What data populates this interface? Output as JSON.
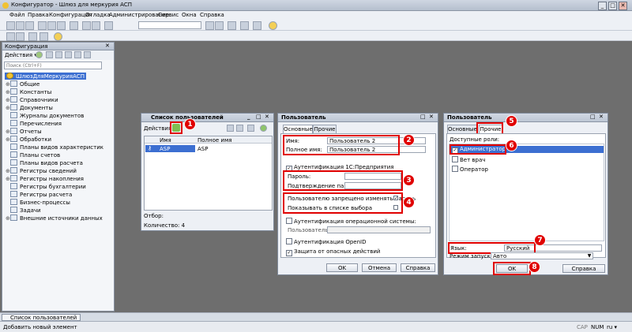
{
  "window": {
    "title": "Конфигуратор - Шлюз для меркурия АСП",
    "min": "_",
    "max": "□",
    "close": "✕"
  },
  "menu": [
    "Файл",
    "Правка",
    "Конфигурация",
    "Отладка",
    "Администрирование",
    "Сервис",
    "Окна",
    "Справка"
  ],
  "config_panel": {
    "title": "Конфигурация",
    "actions_label": "Действия ▾",
    "search_placeholder": "Поиск (Ctrl+F)",
    "root": "ШлюзДляМеркурияАСП",
    "items": [
      "Общие",
      "Константы",
      "Справочники",
      "Документы",
      "Журналы документов",
      "Перечисления",
      "Отчеты",
      "Обработки",
      "Планы видов характеристик",
      "Планы счетов",
      "Планы видов расчета",
      "Регистры сведений",
      "Регистры накопления",
      "Регистры бухгалтерии",
      "Регистры расчета",
      "Бизнес-процессы",
      "Задачи",
      "Внешние источники данных"
    ]
  },
  "users_list": {
    "title": "Список пользователей",
    "actions_label": "Действия ▾",
    "col_name": "Имя",
    "col_full_name": "Полное имя",
    "row_name": "ASP",
    "row_full_name": "ASP",
    "filter_label": "Отбор:",
    "count_label": "Количество: 4"
  },
  "user_dlg": {
    "title": "Пользователь",
    "tab_main": "Основные",
    "tab_other": "Прочие",
    "name_label": "Имя:",
    "name_value": "Пользователь 2",
    "full_name_label": "Полное имя:",
    "full_name_value": "Пользователь 2",
    "auth_1c": "Аутентификация 1С:Предприятия",
    "password_label": "Пароль:",
    "confirm_label": "Подтверждение пароля:",
    "deny_change_pwd": "Пользователю запрещено изменять пароль",
    "show_in_list": "Показывать в списке выбора",
    "auth_os": "Аутентификация операционной системы:",
    "user_label": "Пользователь:",
    "auth_openid": "Аутентификация OpenID",
    "protect": "Защита от опасных действий",
    "ok": "OK",
    "cancel": "Отмена",
    "help": "Справка"
  },
  "roles_dlg": {
    "title": "Пользователь",
    "tab_main": "Основные",
    "tab_other": "Прочие",
    "roles_label": "Доступные роли:",
    "roles": [
      "Администратор",
      "Вет врач",
      "Оператор"
    ],
    "lang_label": "Язык:",
    "lang_value": "Русский",
    "mode_label": "Режим запуска:",
    "mode_value": "Авто",
    "ok": "OK",
    "help": "Справка"
  },
  "markers": [
    "1",
    "2",
    "3",
    "4",
    "5",
    "6",
    "7",
    "8"
  ],
  "taskbar": {
    "tab": "Список пользователей"
  },
  "status": {
    "text": "Добавить новый элемент",
    "cap": "CAP",
    "num": "NUM",
    "lang": "ru ▾"
  },
  "colors": {
    "highlight": "#e00000",
    "selection": "#3c6fd1"
  }
}
